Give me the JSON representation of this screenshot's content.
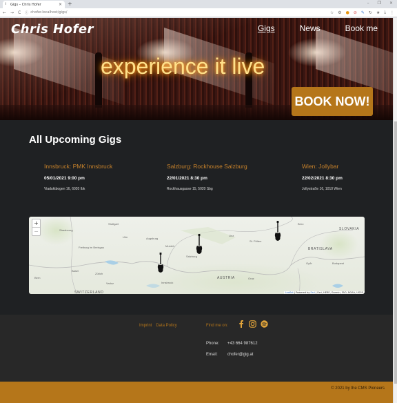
{
  "browser": {
    "tab_title": "Gigs – Chris Hofer",
    "tab_close": "×",
    "new_tab": "+",
    "window_controls": [
      "–",
      "❐",
      "×"
    ],
    "url": "chofer.localhost/gigs/",
    "nav": {
      "back": "←",
      "forward": "→",
      "reload": "C"
    },
    "extensions": [
      "☆",
      "⚙",
      "●",
      "⊘",
      "✎",
      "↻",
      "★",
      "⤓",
      "⋮"
    ]
  },
  "header": {
    "logo": "Chris Hofer",
    "nav": [
      {
        "label": "Gigs",
        "active": true
      },
      {
        "label": "News",
        "active": false
      },
      {
        "label": "Book me",
        "active": false
      }
    ],
    "tagline": "experience it live",
    "cta": "BOOK NOW!"
  },
  "gigs": {
    "title_prefix": "All Upcoming",
    "title_bold": "Gigs",
    "items": [
      {
        "city": "Innsbruck: PMK Innsbruck",
        "date": "05/01/2021 9:00 pm",
        "address": "Viaduktbogen 16, 6020 Ibk"
      },
      {
        "city": "Salzburg: Rockhouse Salzburg",
        "date": "22/01/2021 8:30 pm",
        "address": "Rockhausgasse 15, 5020 Sbg"
      },
      {
        "city": "Wien: Jollybar",
        "date": "22/02/2021 8:30 pm",
        "address": "Jollystraße 16, 1010 Wien"
      }
    ]
  },
  "map": {
    "zoom_in": "+",
    "zoom_out": "−",
    "labels": {
      "stuttgart": "Stuttgart",
      "strasbourg": "Strasbourg",
      "ulm": "Ulm",
      "augsburg": "Augsburg",
      "munich": "Munich",
      "freiburg": "Freiburg im Breisgau",
      "zurich": "Zürich",
      "basel": "Basel",
      "vaduz": "Vaduz",
      "bern": "Bern",
      "switzerland": "SWITZERLAND",
      "salzburg": "Salzburg",
      "innsbruck": "Innsbruck",
      "austria": "AUSTRIA",
      "linz": "Linz",
      "st_polten": "St. Pölten",
      "graz": "Graz",
      "bratislava": "BRATISLAVA",
      "slovakia": "SLOVAKIA",
      "budapest": "Budapest",
      "brno": "Brno",
      "gyor": "Győr"
    },
    "attribution_leaflet": "Leaflet",
    "attribution_powered": "Powered by",
    "attribution_esri": "Esri",
    "attribution_rest": "Esri, HERE, Garmin, FAO, NOAA, USGS"
  },
  "footer": {
    "imprint": "Imprint",
    "data_policy": "Data Policy",
    "find_me": "Find me on:",
    "phone_label": "Phone:",
    "phone": "+43 664 987612",
    "email_label": "Email:",
    "email": "chofer@gig.at",
    "copyright": "© 2021 by the CMS Pioneers"
  },
  "colors": {
    "accent": "#b5761a",
    "gig_title": "#c7822b",
    "page_bg": "#1f2123",
    "footer_bg": "#282828"
  }
}
